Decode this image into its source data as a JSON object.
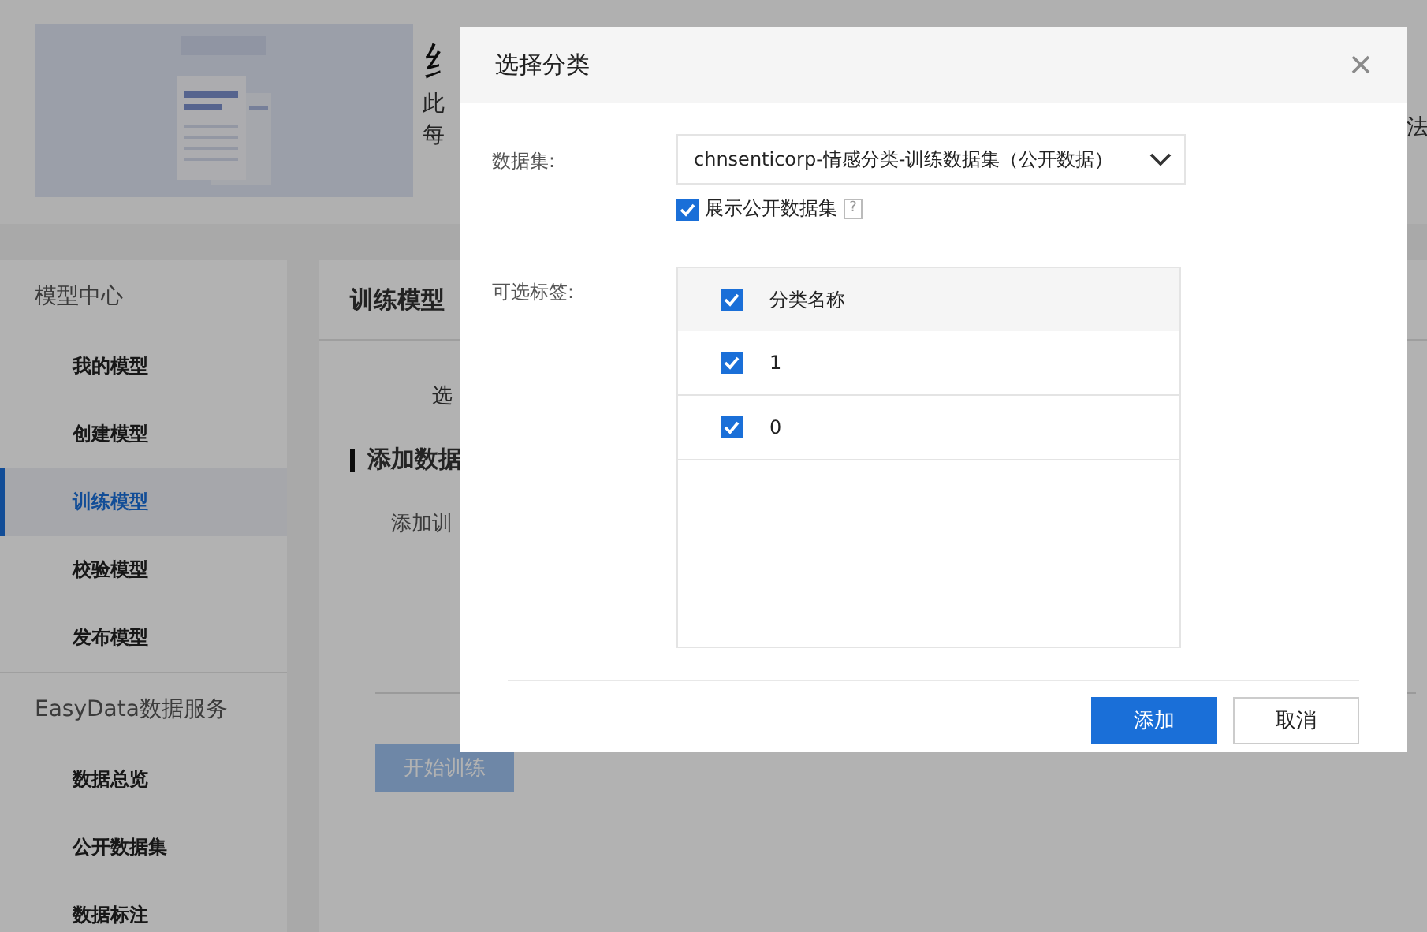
{
  "page": {
    "banner": {
      "title": "纟",
      "lines": [
        "此",
        "每"
      ],
      "side_text": "法"
    },
    "sidebar": {
      "sections": [
        {
          "title": "模型中心",
          "items": [
            {
              "label": "我的模型",
              "selected": false
            },
            {
              "label": "创建模型",
              "selected": false
            },
            {
              "label": "训练模型",
              "selected": true
            },
            {
              "label": "校验模型",
              "selected": false
            },
            {
              "label": "发布模型",
              "selected": false
            }
          ]
        },
        {
          "title": "EasyData数据服务",
          "items": [
            {
              "label": "数据总览",
              "selected": false
            },
            {
              "label": "公开数据集",
              "selected": false
            },
            {
              "label": "数据标注",
              "selected": false
            }
          ]
        }
      ]
    },
    "content": {
      "title": "训练模型",
      "step_label": "选",
      "section_title": "添加数据",
      "field_label": "添加训",
      "primary_button": "开始训练"
    }
  },
  "dialog": {
    "title": "选择分类",
    "dataset_label": "数据集:",
    "dataset_value": "chnsenticorp-情感分类-训练数据集（公开数据）",
    "show_public": {
      "label": "展示公开数据集",
      "checked": true,
      "help": "?"
    },
    "tags_label": "可选标签:",
    "table": {
      "header": {
        "label": "分类名称",
        "checked": true
      },
      "rows": [
        {
          "label": "1",
          "checked": true
        },
        {
          "label": "0",
          "checked": true
        }
      ]
    },
    "buttons": {
      "confirm": "添加",
      "cancel": "取消"
    }
  }
}
